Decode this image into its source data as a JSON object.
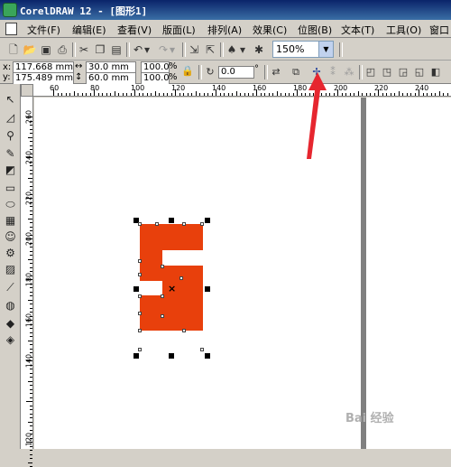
{
  "window": {
    "title": "CorelDRAW 12 - [图形1]"
  },
  "menu": [
    "文件(F)",
    "编辑(E)",
    "查看(V)",
    "版面(L)",
    "排列(A)",
    "效果(C)",
    "位图(B)",
    "文本(T)",
    "工具(O)",
    "窗口"
  ],
  "toolbar": {
    "zoom_value": "150%"
  },
  "property_bar": {
    "x_label": "x:",
    "y_label": "y:",
    "x_value": "117.668 mm",
    "y_value": "175.489 mm",
    "width_value": "30.0 mm",
    "height_value": "60.0 mm",
    "scale_x": "100.0",
    "scale_y": "100.0",
    "percent": "%",
    "rotation_value": "0.0",
    "degree": "°"
  },
  "ruler": {
    "h_labels": [
      "60",
      "80",
      "100",
      "120",
      "140",
      "160",
      "180",
      "200",
      "220",
      "240"
    ],
    "v_labels": [
      "260",
      "240",
      "220",
      "200",
      "180",
      "160",
      "140",
      "120"
    ]
  },
  "shape": {
    "fill": "#e8400c"
  },
  "annotation": {
    "arrow_color": "#e6262f"
  },
  "watermark": "Bai 经验"
}
